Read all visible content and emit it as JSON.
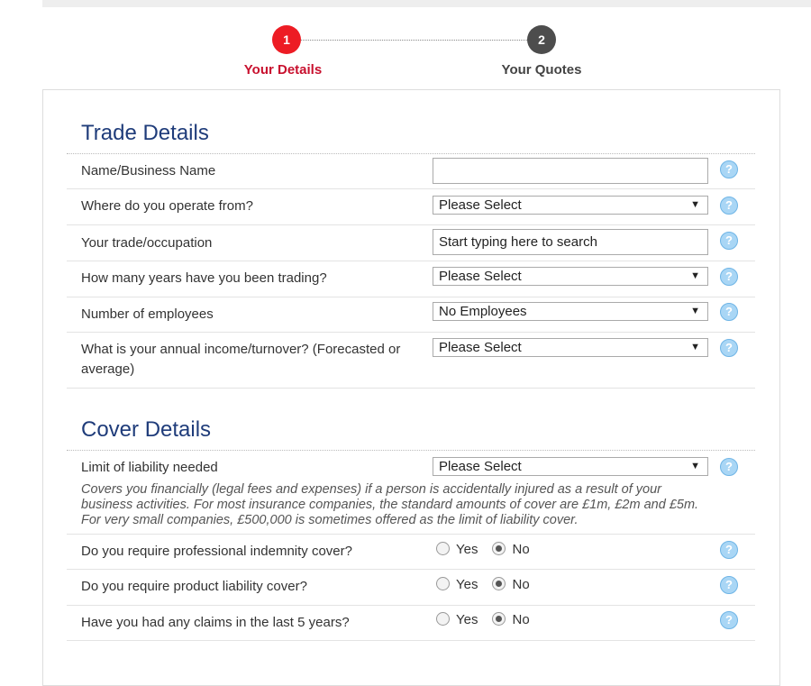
{
  "stepper": {
    "steps": [
      {
        "number": "1",
        "label": "Your Details"
      },
      {
        "number": "2",
        "label": "Your Quotes"
      }
    ]
  },
  "trade": {
    "title": "Trade Details",
    "rows": [
      {
        "label": "Name/Business Name",
        "value": ""
      },
      {
        "label": "Where do you operate from?",
        "value": "Please Select"
      },
      {
        "label": "Your trade/occupation",
        "placeholder": "Start typing here to search"
      },
      {
        "label": "How many years have you been trading?",
        "value": "Please Select"
      },
      {
        "label": "Number of employees",
        "value": "No Employees"
      },
      {
        "label": "What is your annual income/turnover? (Forecasted or average)",
        "value": "Please Select"
      }
    ]
  },
  "cover": {
    "title": "Cover Details",
    "liability": {
      "label": "Limit of liability needed",
      "value": "Please Select",
      "description": "Covers you financially (legal fees and expenses) if a person is accidentally injured as a result of your business activities. For most insurance companies, the standard amounts of cover are £1m, £2m and £5m. For very small companies, £500,000 is sometimes offered as the limit of liability cover."
    },
    "questions": [
      {
        "label": "Do you require professional indemnity cover?",
        "yes": "Yes",
        "no": "No",
        "selected": "No"
      },
      {
        "label": "Do you require product liability cover?",
        "yes": "Yes",
        "no": "No",
        "selected": "No"
      },
      {
        "label": "Have you had any claims in the last 5 years?",
        "yes": "Yes",
        "no": "No",
        "selected": "No"
      }
    ]
  },
  "help_icon": "?",
  "select_arrow": "▼",
  "colors": {
    "step_active": "#ed1c24",
    "step_inactive": "#4d4d4d",
    "section_title": "#1f3c7a",
    "help_icon": "#a9d6f5"
  }
}
